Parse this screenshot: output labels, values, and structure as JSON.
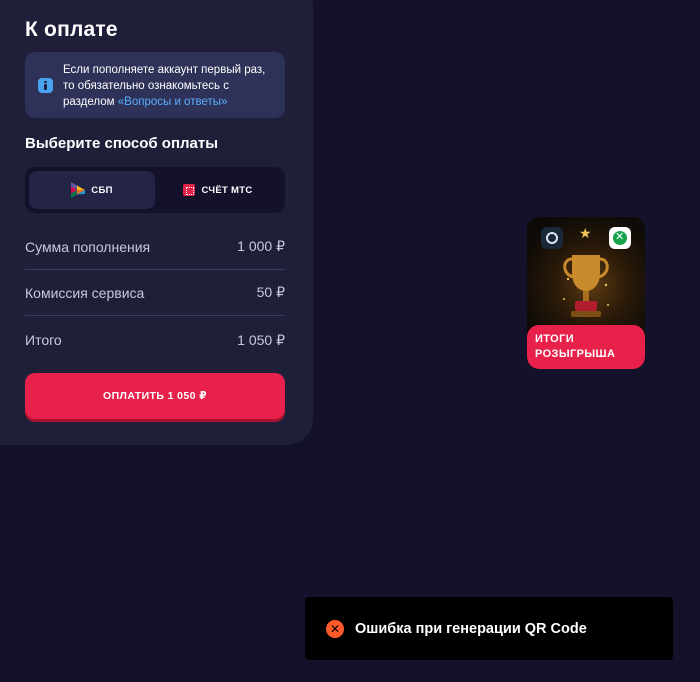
{
  "payment": {
    "title": "К оплате",
    "info": {
      "text": "Если пополняете аккаунт первый раз, то обязательно ознакомьтесь с разделом ",
      "link": "«Вопросы и ответы»"
    },
    "method_title": "Выберите способ оплаты",
    "methods": [
      {
        "label": "СБП",
        "icon": "sbp-icon",
        "selected": true
      },
      {
        "label": "СЧЁТ МТС",
        "icon": "mts-icon",
        "selected": false
      }
    ],
    "rows": [
      {
        "label": "Сумма пополнения",
        "value": "1 000 ₽"
      },
      {
        "label": "Комиссия сервиса",
        "value": "50 ₽"
      },
      {
        "label": "Итого",
        "value": "1 050 ₽"
      }
    ],
    "pay_button": "ОПЛАТИТЬ 1 050 ₽"
  },
  "promo": {
    "label_line1": "ИТОГИ",
    "label_line2": "РОЗЫГРЫША",
    "icons": [
      "steam-icon",
      "star-icon",
      "xbox-icon",
      "trophy-icon"
    ]
  },
  "toast": {
    "message": "Ошибка при генерации QR Code",
    "icon": "error-icon"
  },
  "colors": {
    "background": "#14122a",
    "panel": "#1f1f3a",
    "accent": "#e8214b",
    "link": "#5ab0ff",
    "error": "#ff5a2a"
  }
}
